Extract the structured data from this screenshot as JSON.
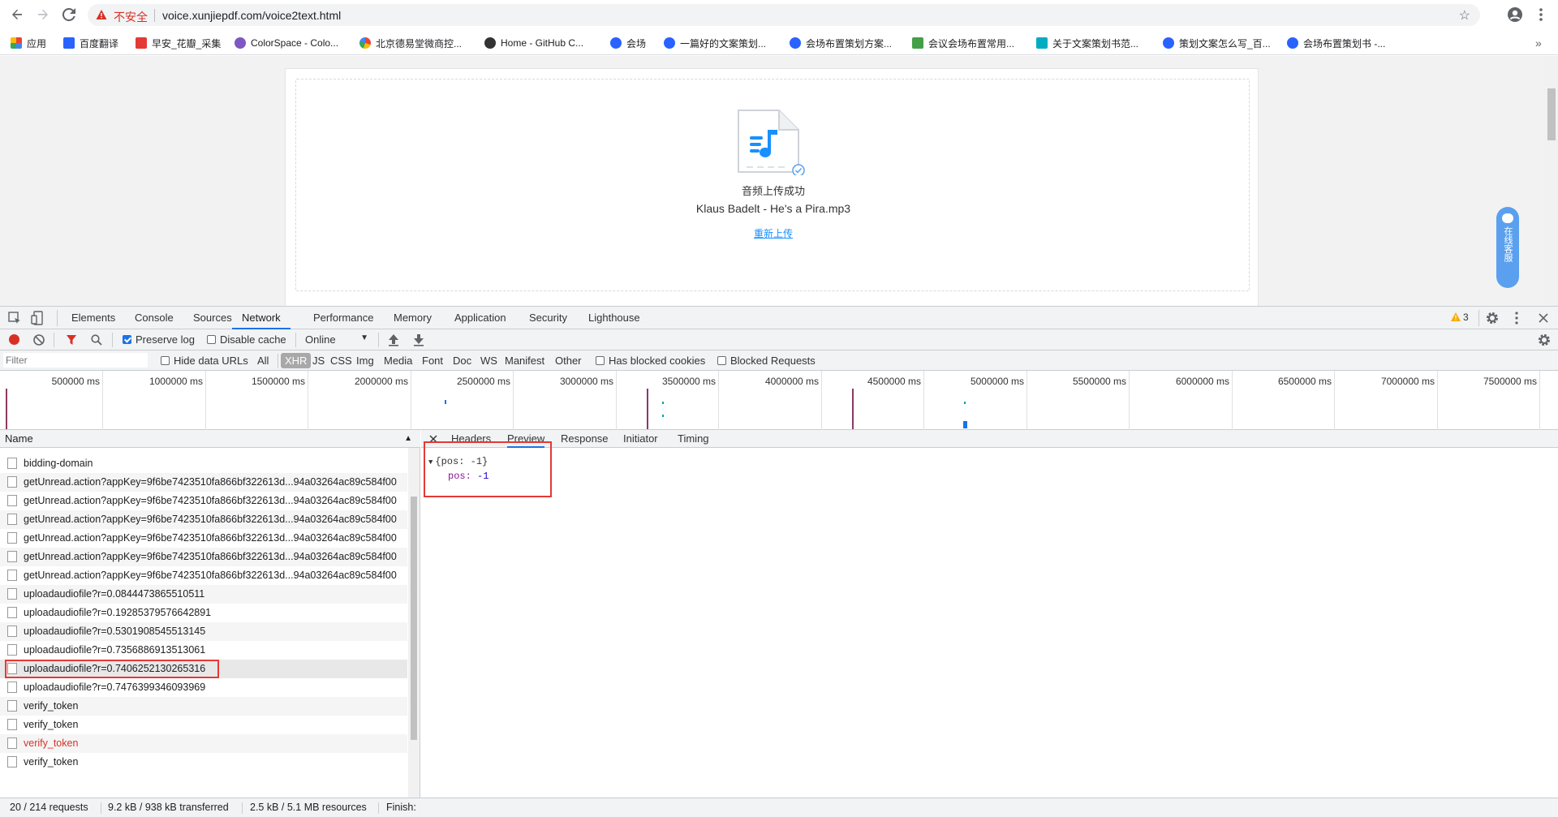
{
  "browser": {
    "insecure_label": "不安全",
    "url": "voice.xunjiepdf.com/voice2text.html"
  },
  "bookmarks": [
    {
      "label": "应用",
      "icon": "apps-grid-icon",
      "color": "#ea4335"
    },
    {
      "label": "百度翻译",
      "icon": "baidu-translate-icon",
      "color": "#2962ff"
    },
    {
      "label": "早安_花瓣_采集",
      "icon": "huaban-icon",
      "color": "#e53935"
    },
    {
      "label": "ColorSpace - Colo...",
      "icon": "colorspace-icon",
      "color": "#7e57c2"
    },
    {
      "label": "北京德易堂微商控...",
      "icon": "google-icon",
      "color": "#34a853"
    },
    {
      "label": "Home - GitHub C...",
      "icon": "github-icon",
      "color": "#333333"
    },
    {
      "label": "会场",
      "icon": "baidu-paw-icon",
      "color": "#2962ff"
    },
    {
      "label": "一篇好的文案策划...",
      "icon": "baidu-paw-icon",
      "color": "#2962ff"
    },
    {
      "label": "会场布置策划方案...",
      "icon": "baidu-paw-icon",
      "color": "#2962ff"
    },
    {
      "label": "会议会场布置常用...",
      "icon": "doc88-icon",
      "color": "#43a047"
    },
    {
      "label": "关于文案策划书范...",
      "icon": "wenku-icon",
      "color": "#00acc1"
    },
    {
      "label": "策划文案怎么写_百...",
      "icon": "baidu-paw-icon",
      "color": "#2962ff"
    },
    {
      "label": "会场布置策划书 -...",
      "icon": "baidu-paw-icon",
      "color": "#2962ff"
    }
  ],
  "page": {
    "upload_status": "音频上传成功",
    "file_name": "Klaus Badelt - He's a Pira.mp3",
    "reupload_link": "重新上传",
    "chat_label": "在线客服"
  },
  "devtools": {
    "tabs": [
      "Elements",
      "Console",
      "Sources",
      "Network",
      "Performance",
      "Memory",
      "Application",
      "Security",
      "Lighthouse"
    ],
    "active_tab": "Network",
    "warning_count": "3",
    "toolbar": {
      "preserve_log": "Preserve log",
      "disable_cache": "Disable cache",
      "throttle": "Online"
    },
    "filter": {
      "placeholder": "Filter",
      "hide_data_urls": "Hide data URLs",
      "types": [
        "All",
        "XHR",
        "JS",
        "CSS",
        "Img",
        "Media",
        "Font",
        "Doc",
        "WS",
        "Manifest",
        "Other"
      ],
      "active_type": "XHR",
      "has_blocked_cookies": "Has blocked cookies",
      "blocked_requests": "Blocked Requests"
    },
    "timeline_ticks": [
      "500000 ms",
      "1000000 ms",
      "1500000 ms",
      "2000000 ms",
      "2500000 ms",
      "3000000 ms",
      "3500000 ms",
      "4000000 ms",
      "4500000 ms",
      "5000000 ms",
      "5500000 ms",
      "6000000 ms",
      "6500000 ms",
      "7000000 ms",
      "7500000 ms"
    ],
    "requests_header": "Name",
    "requests": [
      {
        "name": "bidding-domain"
      },
      {
        "name": "getUnread.action?appKey=9f6be7423510fa866bf322613d...94a03264ac89c584f00"
      },
      {
        "name": "getUnread.action?appKey=9f6be7423510fa866bf322613d...94a03264ac89c584f00"
      },
      {
        "name": "getUnread.action?appKey=9f6be7423510fa866bf322613d...94a03264ac89c584f00"
      },
      {
        "name": "getUnread.action?appKey=9f6be7423510fa866bf322613d...94a03264ac89c584f00"
      },
      {
        "name": "getUnread.action?appKey=9f6be7423510fa866bf322613d...94a03264ac89c584f00"
      },
      {
        "name": "getUnread.action?appKey=9f6be7423510fa866bf322613d...94a03264ac89c584f00"
      },
      {
        "name": "uploadaudiofile?r=0.0844473865510511"
      },
      {
        "name": "uploadaudiofile?r=0.19285379576642891"
      },
      {
        "name": "uploadaudiofile?r=0.5301908545513145"
      },
      {
        "name": "uploadaudiofile?r=0.7356886913513061"
      },
      {
        "name": "uploadaudiofile?r=0.7406252130265316",
        "selected": true
      },
      {
        "name": "uploadaudiofile?r=0.7476399346093969"
      },
      {
        "name": "verify_token"
      },
      {
        "name": "verify_token"
      },
      {
        "name": "verify_token",
        "error": true
      },
      {
        "name": "verify_token"
      }
    ],
    "detail_tabs": [
      "Headers",
      "Preview",
      "Response",
      "Initiator",
      "Timing"
    ],
    "active_detail_tab": "Preview",
    "preview": {
      "summary": "{pos: -1}",
      "key": "pos",
      "value": "-1"
    },
    "status": {
      "requests": "20 / 214 requests",
      "transferred": "9.2 kB / 938 kB transferred",
      "resources": "2.5 kB / 5.1 MB resources",
      "finish": "Finish:"
    }
  }
}
